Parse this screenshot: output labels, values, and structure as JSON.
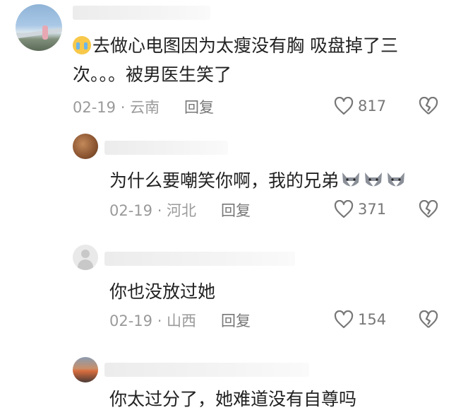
{
  "comments": [
    {
      "text_line1": "去做心电图因为太瘦没有胸 吸盘掉了三",
      "text_line2": "次。。。被男医生笑了",
      "meta": "02-19 · 云南",
      "reply_label": "回复",
      "likes": "817",
      "avatar_icon": "landscape-avatar",
      "emoji": "crying-face-emoji"
    },
    {
      "text": "为什么要嘲笑你啊，我的兄弟",
      "meta": "02-19 · 河北",
      "reply_label": "回复",
      "likes": "371",
      "avatar_icon": "dog-avatar",
      "emoji": "wolf-face-emoji"
    },
    {
      "text": "你也没放过她",
      "meta": "02-19 · 山西",
      "reply_label": "回复",
      "likes": "154",
      "avatar_icon": "default-user-avatar"
    },
    {
      "text": "你太过分了，她难道没有自尊吗",
      "avatar_icon": "sunset-avatar"
    }
  ],
  "colors": {
    "text": "#222222",
    "meta": "#9a9a9a",
    "icon": "#777777"
  }
}
